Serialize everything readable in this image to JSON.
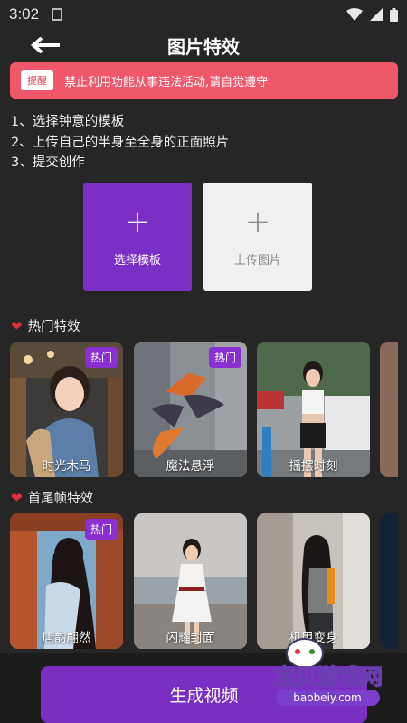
{
  "status_bar": {
    "time": "3:02"
  },
  "header": {
    "title": "图片特效"
  },
  "warning": {
    "tag": "提醒",
    "text": "禁止利用功能从事违法活动,请自觉遵守"
  },
  "steps": [
    "1、选择钟意的模板",
    "2、上传自己的半身至全身的正面照片",
    "3、提交创作"
  ],
  "actions": {
    "template_plus": "+",
    "template_label": "选择模板",
    "upload_plus": "+",
    "upload_label": "上传图片"
  },
  "hot_section": {
    "title": "热门特效",
    "items": [
      {
        "label": "时光木马",
        "badge": "热门"
      },
      {
        "label": "魔法悬浮",
        "badge": "热门"
      },
      {
        "label": "摇摆时刻",
        "badge": ""
      }
    ]
  },
  "frame_section": {
    "title": "首尾帧特效",
    "items": [
      {
        "label": "唐韵翩然",
        "badge": "热门"
      },
      {
        "label": "闪耀封面",
        "badge": ""
      },
      {
        "label": "机甲变身",
        "badge": ""
      }
    ]
  },
  "generate": {
    "label": "生成视频"
  },
  "watermark": {
    "title": "宝贝游戏网",
    "url": "baobeiy.com"
  },
  "colors": {
    "accent": "#7b2fc4",
    "warning": "#f0586a",
    "background": "#262626"
  }
}
